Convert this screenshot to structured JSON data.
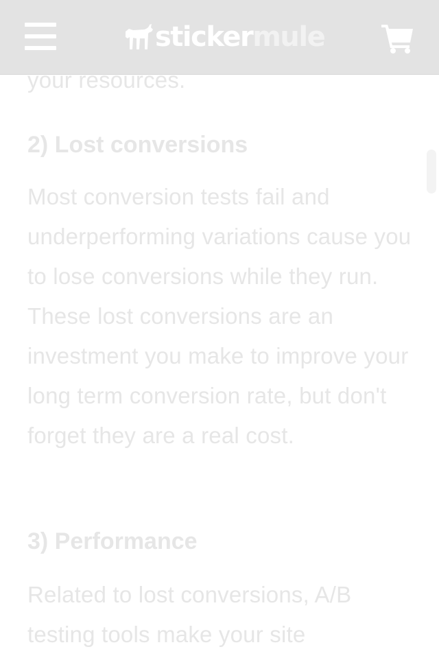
{
  "header": {
    "menu_icon": "hamburger-menu-icon",
    "logo": {
      "icon": "mule-logo-icon",
      "text_part1": "sticker",
      "text_part2": "mule"
    },
    "cart_icon": "shopping-cart-icon"
  },
  "article": {
    "prev_paragraph_tail": "your resources.",
    "sections": [
      {
        "heading": "2) Lost conversions",
        "body": "Most conversion tests fail and underperforming variations cause you to lose conversions while they run. These lost conversions are an investment you make to improve your long term conversion rate, but don't forget they are a real cost."
      },
      {
        "heading": "3) Performance",
        "body": "Related to lost conversions, A/B testing tools make your site"
      }
    ]
  },
  "colors": {
    "header_background": "#e3e3e3",
    "header_icons": "#ffffff",
    "article_text": "#e6e6e6",
    "page_background": "#ffffff"
  }
}
